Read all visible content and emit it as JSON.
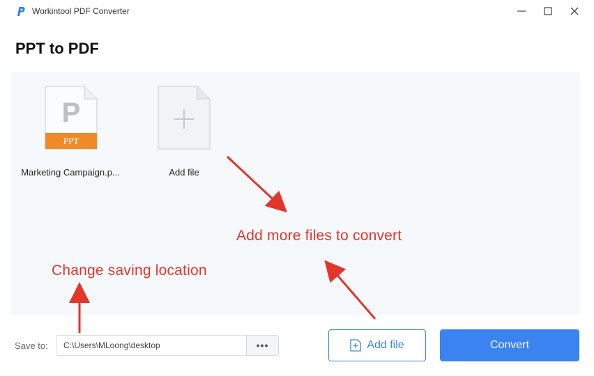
{
  "window": {
    "title": "Workintool PDF Converter",
    "controls": [
      "minimize-icon",
      "maximize-icon",
      "close-icon"
    ]
  },
  "page": {
    "title": "PPT to PDF"
  },
  "files": [
    {
      "name": "Marketing Campaign.p...",
      "type_badge": "PPT",
      "icon_letter": "P"
    }
  ],
  "add_tile": {
    "label": "Add file",
    "icon": "plus-icon"
  },
  "annotations": {
    "add_more": "Add more files to convert",
    "change_location": "Change saving location"
  },
  "bottom": {
    "save_label": "Save to:",
    "path_value": "C:\\Users\\MLoong\\desktop",
    "browse_label": "•••",
    "add_file_label": "Add file",
    "convert_label": "Convert"
  },
  "colors": {
    "accent": "#3a83f1",
    "ppt_badge": "#ef8a28",
    "annotation": "#e4352a"
  }
}
